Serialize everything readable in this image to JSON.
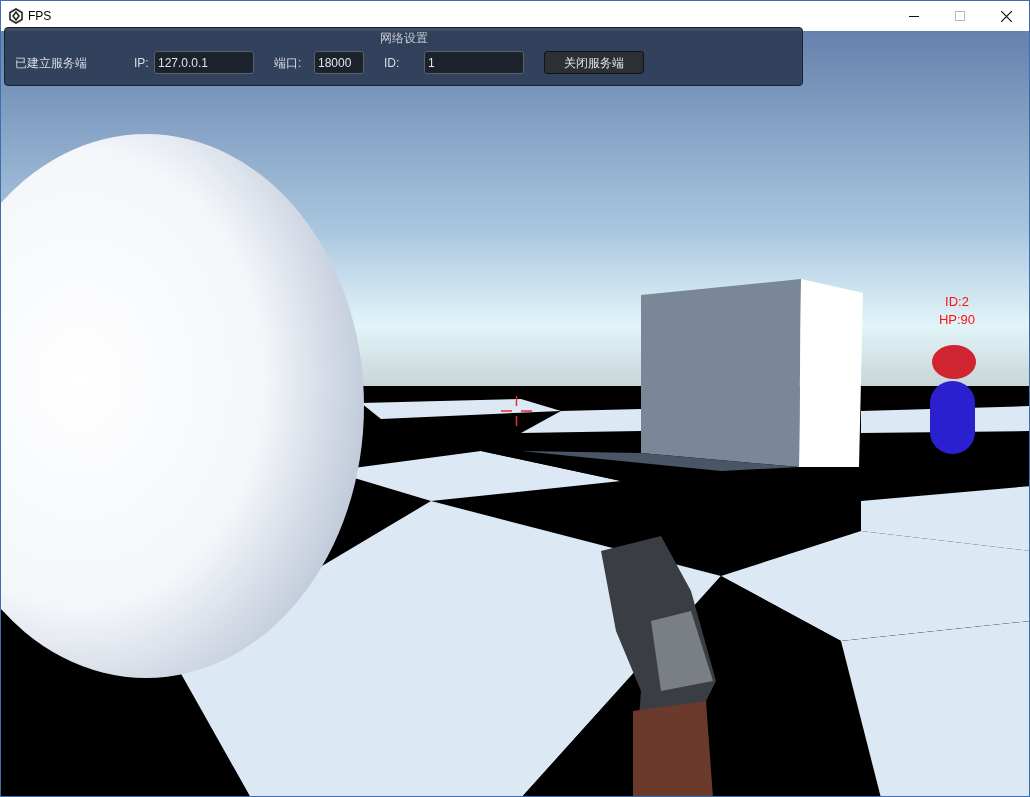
{
  "window": {
    "title": "FPS"
  },
  "network_panel": {
    "title": "网络设置",
    "status": "已建立服务端",
    "fields": [
      {
        "label": "IP:",
        "value": "127.0.0.1"
      },
      {
        "label": "端口:",
        "value": "18000"
      },
      {
        "label": "ID:",
        "value": "1"
      }
    ],
    "button": "关闭服务端"
  },
  "player_tag": {
    "id": "ID:2",
    "hp": "HP:90"
  }
}
